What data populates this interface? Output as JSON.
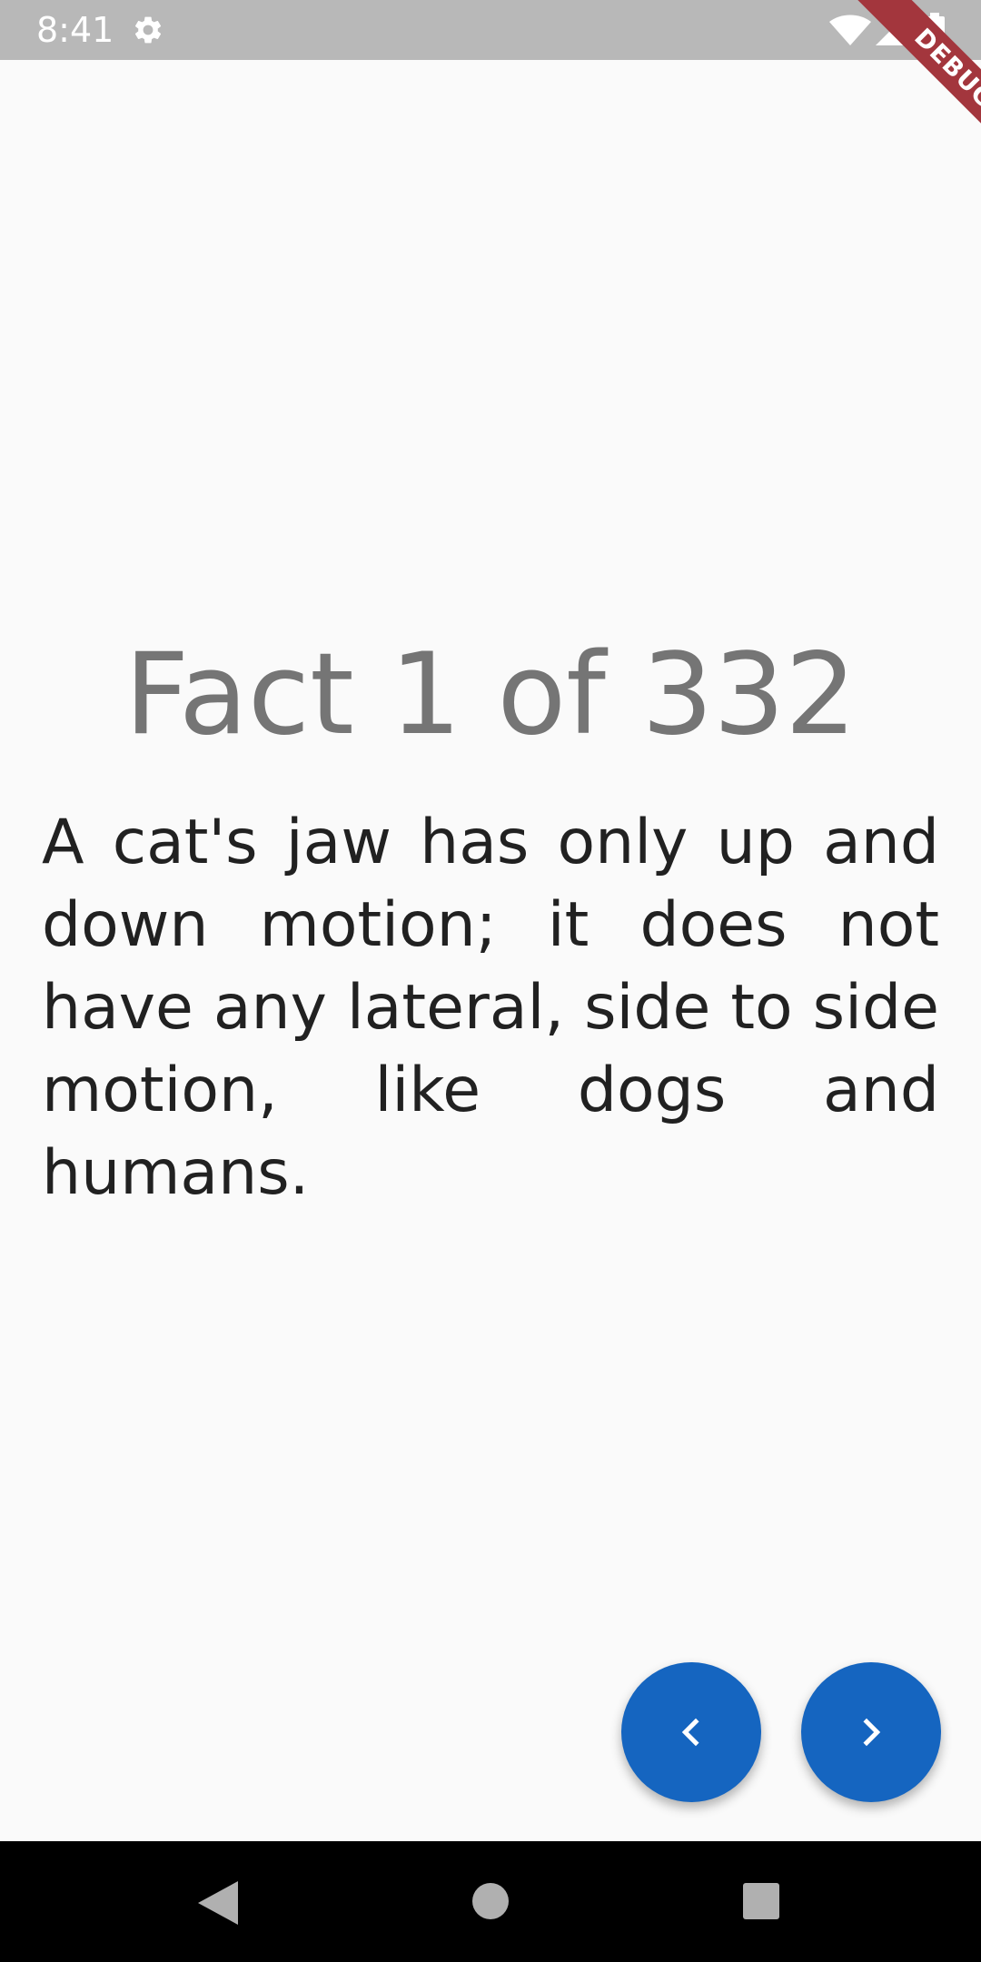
{
  "status_bar": {
    "time": "8:41",
    "icons": [
      "gear-icon",
      "wifi-icon",
      "cell-signal-icon",
      "battery-icon"
    ]
  },
  "debug_banner": {
    "label": "DEBUG",
    "color": "#a3363d"
  },
  "fact": {
    "title": "Fact 1 of 332",
    "text": "A cat's jaw has only up and down motion; it does not have any lateral, side to side motion, like dogs and humans."
  },
  "buttons": {
    "previous_icon": "chevron-left-icon",
    "next_icon": "chevron-right-icon",
    "color": "#1565c0"
  },
  "nav_bar": {
    "icons": [
      "back-icon",
      "home-icon",
      "recents-icon"
    ]
  },
  "colors": {
    "background": "#fafafa",
    "status_bar": "#b8b8b8",
    "title_text": "#757575",
    "body_text": "#212121"
  }
}
